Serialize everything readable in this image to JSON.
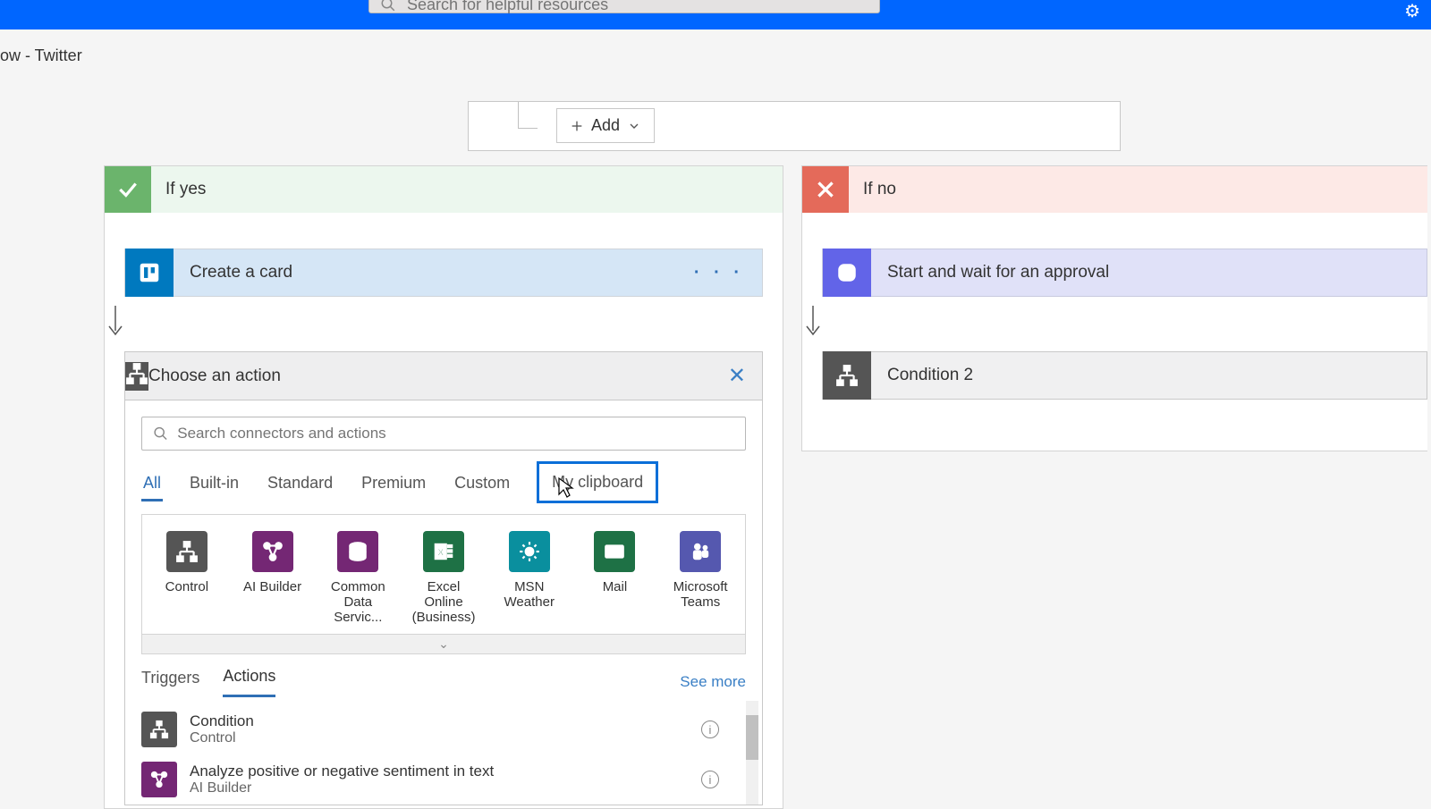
{
  "topbar": {
    "search_placeholder": "Search for helpful resources"
  },
  "breadcrumb": "ow - Twitter",
  "condition": {
    "add_label": "Add"
  },
  "branches": {
    "yes": {
      "title": "If yes"
    },
    "no": {
      "title": "If no"
    }
  },
  "steps": {
    "trello": {
      "title": "Create a card",
      "menu": "· · ·"
    },
    "choose": {
      "title": "Choose an action"
    },
    "approval": {
      "title": "Start and wait for an approval"
    },
    "condition2": {
      "title": "Condition 2"
    }
  },
  "action_search_placeholder": "Search connectors and actions",
  "filter_tabs": [
    "All",
    "Built-in",
    "Standard",
    "Premium",
    "Custom",
    "My clipboard"
  ],
  "connectors": [
    {
      "label": "Control",
      "color": "#555"
    },
    {
      "label": "AI Builder",
      "color": "#742774"
    },
    {
      "label": "Common Data Servic...",
      "color": "#742774"
    },
    {
      "label": "Excel Online (Business)",
      "color": "#1e7145"
    },
    {
      "label": "MSN Weather",
      "color": "#0a8f9e"
    },
    {
      "label": "Mail",
      "color": "#1e7145"
    },
    {
      "label": "Microsoft Teams",
      "color": "#5558af"
    }
  ],
  "secondary_tabs": {
    "triggers": "Triggers",
    "actions": "Actions",
    "seemore": "See more"
  },
  "action_list": [
    {
      "title": "Condition",
      "sub": "Control",
      "color": "#555"
    },
    {
      "title": "Analyze positive or negative sentiment in text",
      "sub": "AI Builder",
      "color": "#742774"
    }
  ]
}
